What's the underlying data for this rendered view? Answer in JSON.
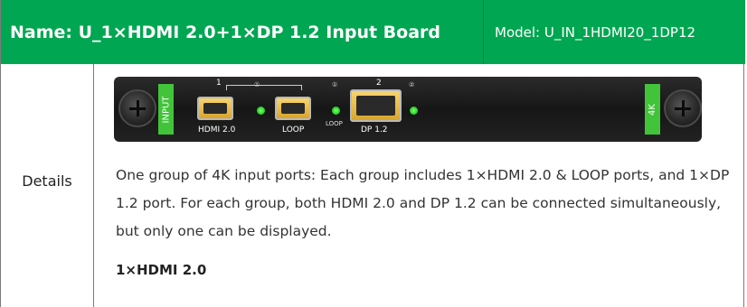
{
  "header": {
    "name": "Name: U_1×HDMI 2.0+1×DP 1.2 Input Board",
    "model": "Model: U_IN_1HDMI20_1DP12"
  },
  "details_label": "Details",
  "board": {
    "strip_left": "INPUT",
    "strip_right": "4K",
    "group1_number": "1",
    "group2_number": "2",
    "led_marker_1": "①",
    "led_marker_2": "①",
    "led_marker_3": "②",
    "port_hdmi_label": "HDMI 2.0",
    "port_loop_label": "LOOP",
    "led_loop_label": "LOOP",
    "port_dp_label": "DP 1.2"
  },
  "description": "One group of 4K input ports: Each group includes 1×HDMI 2.0 & LOOP ports, and 1×DP 1.2 port. For each group, both HDMI 2.0 and DP 1.2 can be connected simultaneously, but only one can be displayed.",
  "subheading": "1×HDMI 2.0",
  "colors": {
    "header_green": "#00a651",
    "strip_green": "#41c43a",
    "led_green": "#2bd629",
    "port_gold": "#e8b53a"
  }
}
